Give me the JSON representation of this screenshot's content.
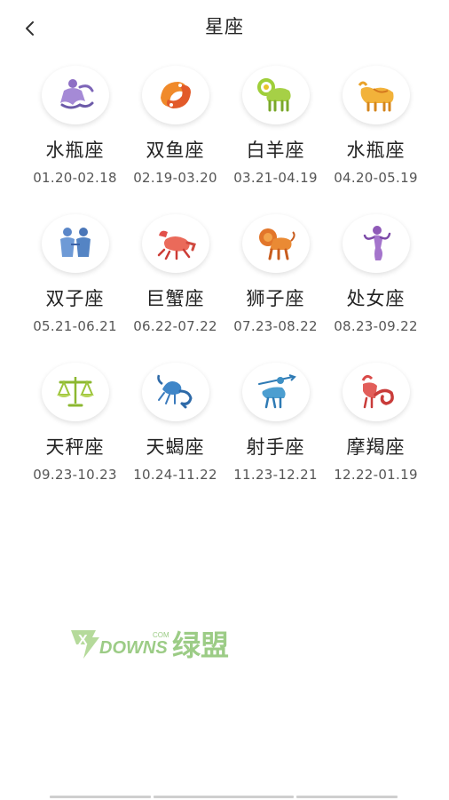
{
  "header": {
    "title": "星座",
    "back_icon": "chevron-left-icon"
  },
  "zodiac": [
    {
      "name": "水瓶座",
      "dates": "01.20-02.18",
      "icon": "aquarius-icon",
      "color": "#8e6fc4"
    },
    {
      "name": "双鱼座",
      "dates": "02.19-03.20",
      "icon": "pisces-icon",
      "color": "#ef7a2a"
    },
    {
      "name": "白羊座",
      "dates": "03.21-04.19",
      "icon": "aries-icon",
      "color": "#8cbf2e"
    },
    {
      "name": "水瓶座",
      "dates": "04.20-05.19",
      "icon": "taurus-icon",
      "color": "#e9a22a"
    },
    {
      "name": "双子座",
      "dates": "05.21-06.21",
      "icon": "gemini-icon",
      "color": "#5a86c8"
    },
    {
      "name": "巨蟹座",
      "dates": "06.22-07.22",
      "icon": "cancer-icon",
      "color": "#e2504a"
    },
    {
      "name": "狮子座",
      "dates": "07.23-08.22",
      "icon": "leo-icon",
      "color": "#e2762a"
    },
    {
      "name": "处女座",
      "dates": "08.23-09.22",
      "icon": "virgo-icon",
      "color": "#8f5ab8"
    },
    {
      "name": "天秤座",
      "dates": "09.23-10.23",
      "icon": "libra-icon",
      "color": "#9cc43a"
    },
    {
      "name": "天蝎座",
      "dates": "10.24-11.22",
      "icon": "scorpio-icon",
      "color": "#3f86c8"
    },
    {
      "name": "射手座",
      "dates": "11.23-12.21",
      "icon": "sagittarius-icon",
      "color": "#3d8fc4"
    },
    {
      "name": "摩羯座",
      "dates": "12.22-01.19",
      "icon": "capricorn-icon",
      "color": "#d94a48"
    }
  ],
  "watermark": {
    "brand": "DOWNS",
    "badge": "X",
    "cn": "绿盟",
    "suffix": "COM",
    "color": "#8cbf6a"
  }
}
